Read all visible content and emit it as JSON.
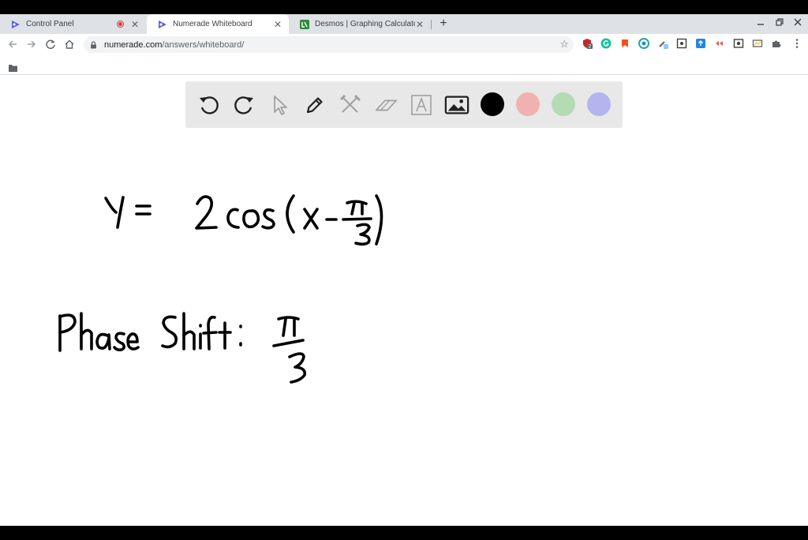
{
  "tabs": [
    {
      "title": "Control Panel",
      "recording": true
    },
    {
      "title": "Numerade Whiteboard",
      "active": true
    },
    {
      "title": "Desmos | Graphing Calculator"
    }
  ],
  "address": {
    "host": "numerade.com",
    "path": "/answers/whiteboard/"
  },
  "extensions": {
    "badge_count": "2"
  },
  "whiteboard": {
    "tools": [
      "undo-icon",
      "redo-icon",
      "select-pointer-icon",
      "pen-icon",
      "tools-icon",
      "eraser-icon",
      "text-icon",
      "image-icon"
    ],
    "colors": [
      "#000000",
      "#f0b2b0",
      "#b4dbb4",
      "#b4b4ee"
    ]
  },
  "handwritten": {
    "equation": "y = 2cos(x − π/3)",
    "phase_shift": "Phase Shift: π/3"
  }
}
